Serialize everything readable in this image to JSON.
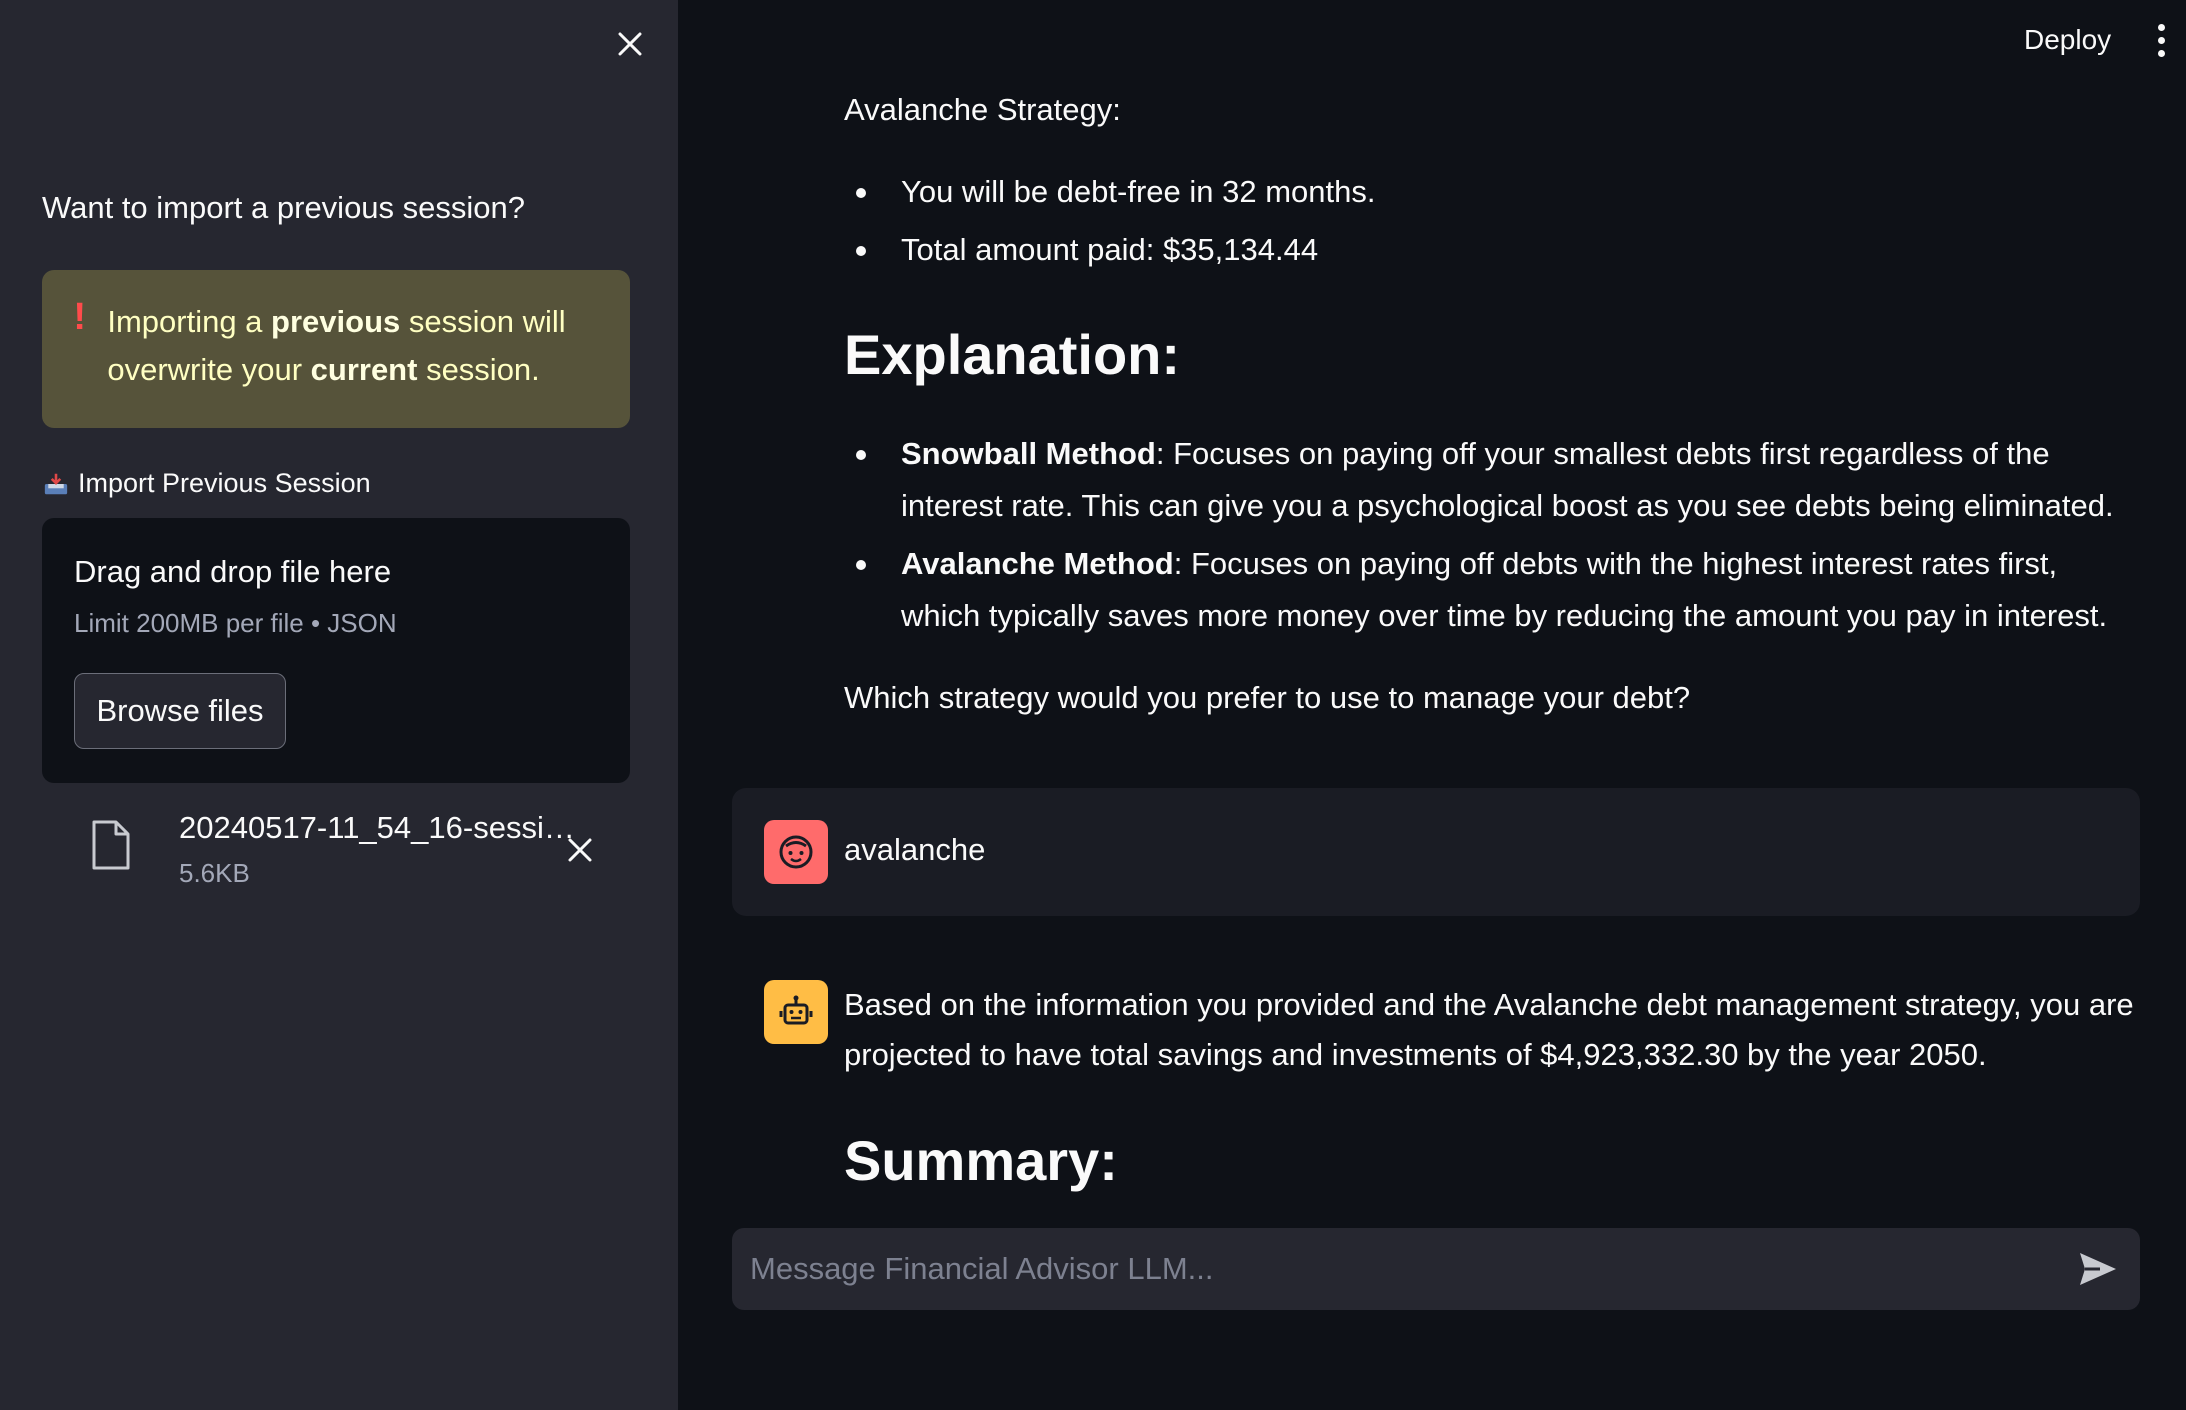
{
  "sidebar": {
    "heading": "Want to import a previous session?",
    "warning": {
      "part1": "Importing a ",
      "bold1": "previous",
      "part2": " session will overwrite your ",
      "bold2": "current",
      "part3": " session."
    },
    "uploader": {
      "label": "Import Previous Session",
      "drag_text": "Drag and drop file here",
      "limit_text": "Limit 200MB per file • JSON",
      "browse_label": "Browse files"
    },
    "file": {
      "name": "20240517-11_54_16-sessi…",
      "size": "5.6KB"
    }
  },
  "header": {
    "deploy_label": "Deploy"
  },
  "main": {
    "avalanche_heading": "Avalanche Strategy:",
    "avalanche_bullets": [
      "You will be debt-free in 32 months.",
      "Total amount paid: $35,134.44"
    ],
    "explanation_heading": "Explanation:",
    "explanation_items": [
      {
        "term": "Snowball Method",
        "text": ": Focuses on paying off your smallest debts first regardless of the interest rate. This can give you a psychological boost as you see debts being eliminated."
      },
      {
        "term": "Avalanche Method",
        "text": ": Focuses on paying off debts with the highest interest rates first, which typically saves more money over time by reducing the amount you pay in interest."
      }
    ],
    "question": "Which strategy would you prefer to use to manage your debt?",
    "user_message": "avalanche",
    "bot_message": "Based on the information you provided and the Avalanche debt management strategy, you are projected to have total savings and investments of $4,923,332.30 by the year 2050.",
    "summary_heading": "Summary:"
  },
  "chat_input": {
    "placeholder": "Message Financial Advisor LLM..."
  },
  "colors": {
    "sidebar_bg": "#262730",
    "main_bg": "#0e1117",
    "warning_bg": "#56533a",
    "user_avatar": "#ff6b6b",
    "bot_avatar": "#ffbd45"
  },
  "icons": [
    "close-icon",
    "exclamation-icon",
    "inbox-tray-icon",
    "file-icon",
    "user-face-icon",
    "robot-icon",
    "send-icon",
    "kebab-menu-icon"
  ]
}
